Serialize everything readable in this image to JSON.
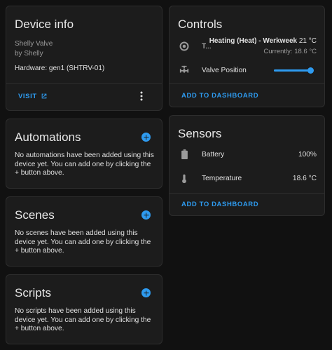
{
  "device_info": {
    "title": "Device info",
    "model": "Shelly Valve",
    "manufacturer": "by Shelly",
    "hardware_label": "Hardware:",
    "hardware_value": "gen1 (SHTRV-01)",
    "visit_label": "VISIT"
  },
  "automations": {
    "title": "Automations",
    "text": "No automations have been added using this device yet. You can add one by clicking the + button above."
  },
  "scenes": {
    "title": "Scenes",
    "text": "No scenes have been added using this device yet. You can add one by clicking the + button above."
  },
  "scripts": {
    "title": "Scripts",
    "text": "No scripts have been added using this device yet. You can add one by clicking the + button above."
  },
  "controls": {
    "title": "Controls",
    "thermostat_name": "T...",
    "thermostat_mode": "Heating (Heat) - Werkweek",
    "thermostat_target": "21 °C",
    "thermostat_current": "Currently: 18.6 °C",
    "valve_label": "Valve Position",
    "valve_position_fraction": 1.0,
    "add_label": "ADD TO DASHBOARD"
  },
  "sensors": {
    "title": "Sensors",
    "items": [
      {
        "label": "Battery",
        "value": "100%",
        "icon": "battery-icon"
      },
      {
        "label": "Temperature",
        "value": "18.6 °C",
        "icon": "thermometer-icon"
      }
    ],
    "add_label": "ADD TO DASHBOARD"
  },
  "colors": {
    "background": "#111111",
    "card": "#1c1c1c",
    "accent": "#2e9bf0",
    "text": "#e1e1e1",
    "muted": "#9b9b9b"
  }
}
